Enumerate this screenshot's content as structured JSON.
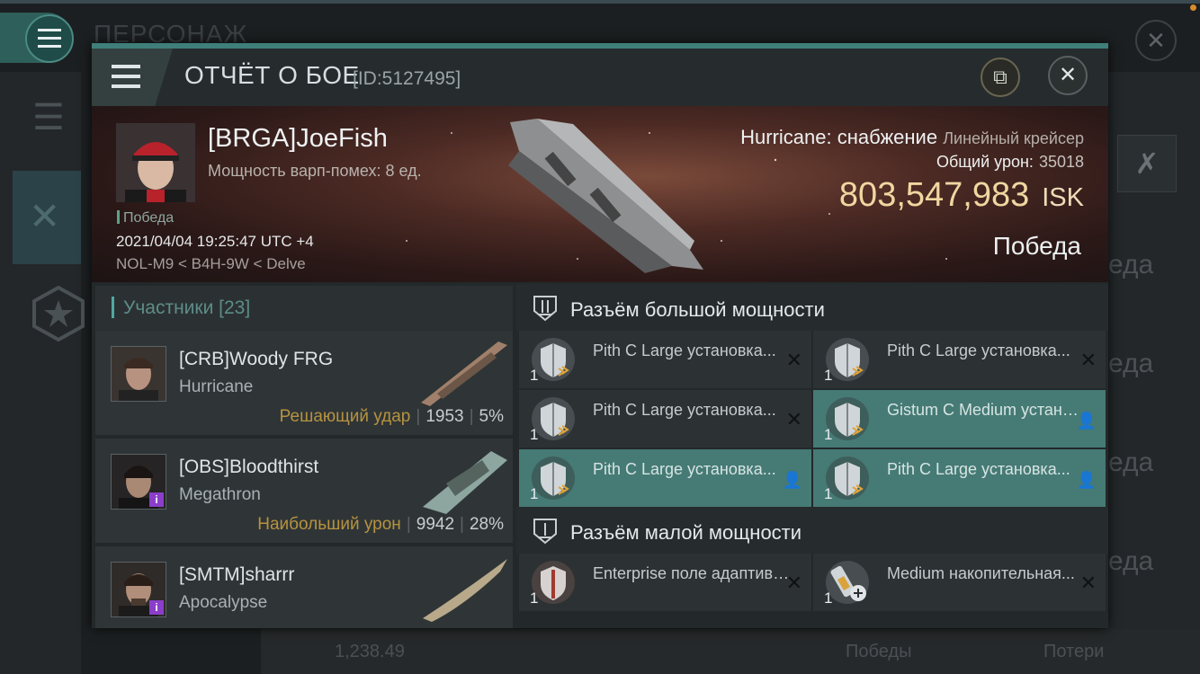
{
  "background": {
    "screen_title": "ПЕРСОНАЖ",
    "right_list": [
      "еда",
      "еда",
      "еда",
      "еда"
    ],
    "bottom_value": "1,238.49",
    "bottom_wins": "Победы",
    "bottom_losses": "Потери"
  },
  "dialog": {
    "title": "ОТЧЁТ О БОЕ",
    "id": "[ID:5127495]",
    "close_glyph": "✕",
    "external_glyph": "⧉"
  },
  "victim": {
    "pilot": "[BRGA]JoeFish",
    "warp_strength": "Мощность варп-помех: 8 ед.",
    "tag": "Победа",
    "datetime": "2021/04/04 19:25:47 UTC +4",
    "location": "NOL-M9 < B4H-9W < Delve",
    "ship_name": "Hurricane: снабжение",
    "ship_class": "Линейный крейсер",
    "total_damage_label": "Общий урон:",
    "total_damage_value": "35018",
    "isk_value": "803,547,983",
    "isk_unit": "ISK",
    "result": "Победа"
  },
  "participants": {
    "header": "Участники [23]",
    "rows": [
      {
        "name": "[CRB]Woody FRG",
        "ship": "Hurricane",
        "tag": "Решающий удар",
        "damage": "1953",
        "percent": "5%",
        "badge": "",
        "ship_color": "#a0806a"
      },
      {
        "name": "[OBS]Bloodthirst",
        "ship": "Megathron",
        "tag": "Наибольший урон",
        "damage": "9942",
        "percent": "28%",
        "badge": "i",
        "ship_color": "#8ea6a0"
      },
      {
        "name": "[SMTM]sharrr",
        "ship": "Apocalypse",
        "tag": "",
        "damage": "",
        "percent": "",
        "badge": "i",
        "ship_color": "#b8a98a"
      }
    ]
  },
  "modules": {
    "high_title": "Разъём большой мощности",
    "low_title": "Разъём малой мощности",
    "high": [
      {
        "qty": "1",
        "name": "Pith C Large установка...",
        "state": "destroyed",
        "icon": "shield-booster-icon"
      },
      {
        "qty": "1",
        "name": "Pith C Large установка...",
        "state": "destroyed",
        "icon": "shield-booster-icon"
      },
      {
        "qty": "1",
        "name": "Pith C Large установка...",
        "state": "destroyed",
        "icon": "shield-booster-icon"
      },
      {
        "qty": "1",
        "name": "Gistum C Medium установк...",
        "state": "dropped",
        "icon": "shield-booster-icon"
      },
      {
        "qty": "1",
        "name": "Pith C Large установка...",
        "state": "dropped",
        "icon": "shield-booster-icon"
      },
      {
        "qty": "1",
        "name": "Pith C Large установка...",
        "state": "dropped",
        "icon": "shield-booster-icon"
      }
    ],
    "low": [
      {
        "qty": "1",
        "name": "Enterprise поле адаптивно...",
        "state": "destroyed",
        "icon": "shield-hardener-icon"
      },
      {
        "qty": "1",
        "name": "Medium накопительная...",
        "state": "destroyed",
        "icon": "capacitor-battery-icon"
      }
    ]
  }
}
